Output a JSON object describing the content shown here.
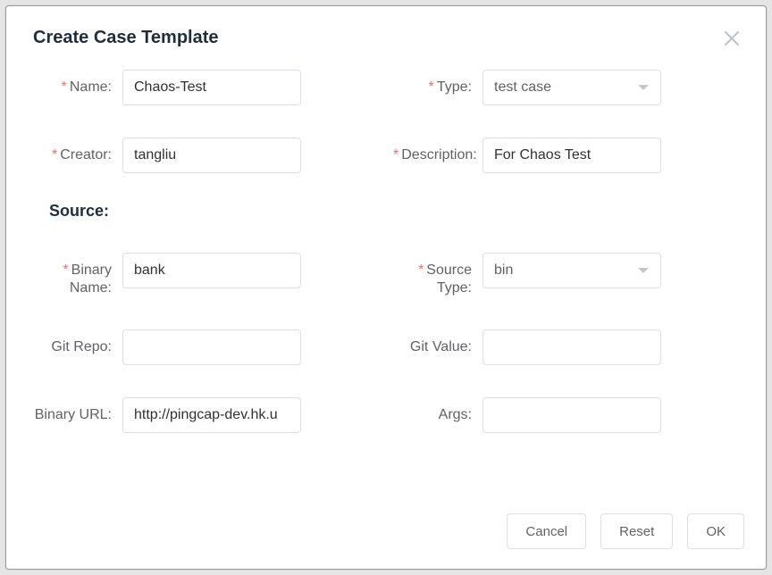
{
  "modal": {
    "title": "Create Case Template"
  },
  "form": {
    "name": {
      "label": "Name:",
      "value": "Chaos-Test",
      "required": true
    },
    "type": {
      "label": "Type:",
      "value": "test case",
      "required": true
    },
    "creator": {
      "label": "Creator:",
      "value": "tangliu",
      "required": true
    },
    "description": {
      "label": "Description:",
      "value": "For Chaos Test",
      "required": true
    },
    "source_section": "Source:",
    "binary_name": {
      "label": "Binary Name:",
      "value": "bank",
      "required": true
    },
    "source_type": {
      "label": "Source Type:",
      "value": "bin",
      "required": true
    },
    "git_repo": {
      "label": "Git Repo:",
      "value": "",
      "required": false
    },
    "git_value": {
      "label": "Git Value:",
      "value": "",
      "required": false
    },
    "binary_url": {
      "label": "Binary URL:",
      "value": "http://pingcap-dev.hk.u",
      "required": false
    },
    "args": {
      "label": "Args:",
      "value": "",
      "required": false
    }
  },
  "buttons": {
    "cancel": "Cancel",
    "reset": "Reset",
    "ok": "OK"
  }
}
